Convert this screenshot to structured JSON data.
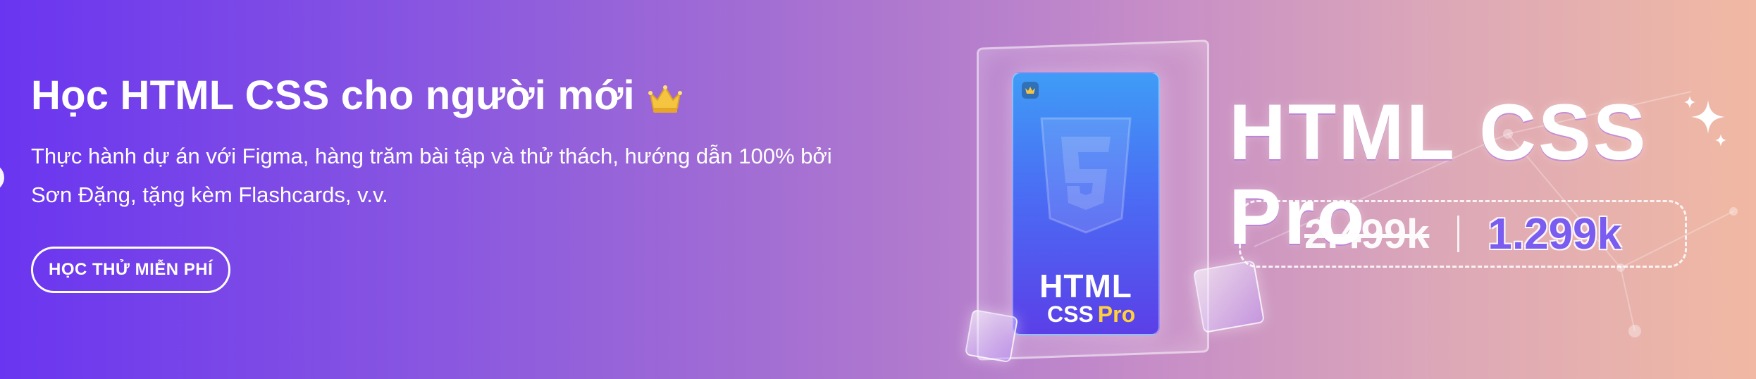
{
  "banner": {
    "title": "Học HTML CSS cho người mới",
    "description": "Thực hành dự án với Figma, hàng trăm bài tập và thử thách, hướng dẫn 100% bởi Sơn Đặng, tặng kèm Flashcards, v.v.",
    "cta_label": "HỌC THỬ MIỄN PHÍ",
    "title_icon": "crown-icon"
  },
  "product": {
    "card_title": "HTML",
    "card_sub_css": "CSS",
    "card_sub_pro": "Pro",
    "name": "HTML CSS Pro",
    "old_price": "2.499k",
    "new_price": "1.299k"
  },
  "colors": {
    "gradient_start": "#6a35f0",
    "gradient_end": "#f1b9a3",
    "crown_gold": "#f5c542",
    "price_purple": "#7a5cf0"
  }
}
